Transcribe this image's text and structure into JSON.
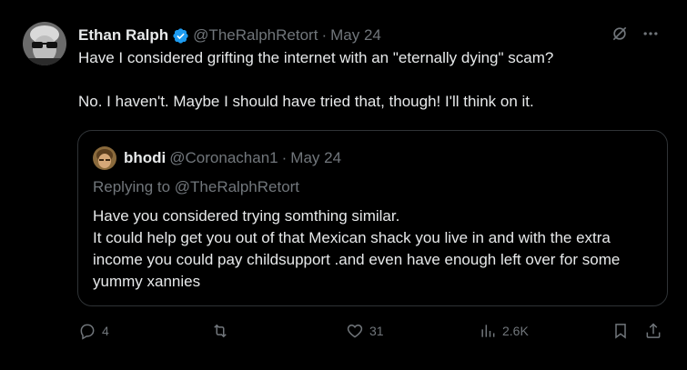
{
  "tweet": {
    "author_name": "Ethan Ralph",
    "author_handle": "@TheRalphRetort",
    "separator": "·",
    "date": "May 24",
    "text": "Have I considered grifting the internet with an \"eternally dying\" scam?\n\nNo. I haven't. Maybe I should have tried that, though! I'll think on it."
  },
  "quote": {
    "author_name": "bhodi",
    "author_handle": "@Coronachan1",
    "separator": "·",
    "date": "May 24",
    "replying_to": "Replying to @TheRalphRetort",
    "text": "Have you considered trying somthing similar.\nIt could help get you out of that Mexican shack you live in and with the extra income you could pay childsupport .and even have enough left over for some yummy xannies"
  },
  "actions": {
    "replies": "4",
    "reposts": "",
    "likes": "31",
    "views": "2.6K"
  },
  "colors": {
    "background": "#000000",
    "text": "#e7e9ea",
    "muted": "#71767b",
    "border": "#2f3336",
    "verified": "#1d9bf0"
  },
  "icons": [
    "verified-badge-icon",
    "grok-icon",
    "more-icon",
    "reply-icon",
    "repost-icon",
    "like-icon",
    "views-icon",
    "bookmark-icon",
    "share-icon"
  ]
}
